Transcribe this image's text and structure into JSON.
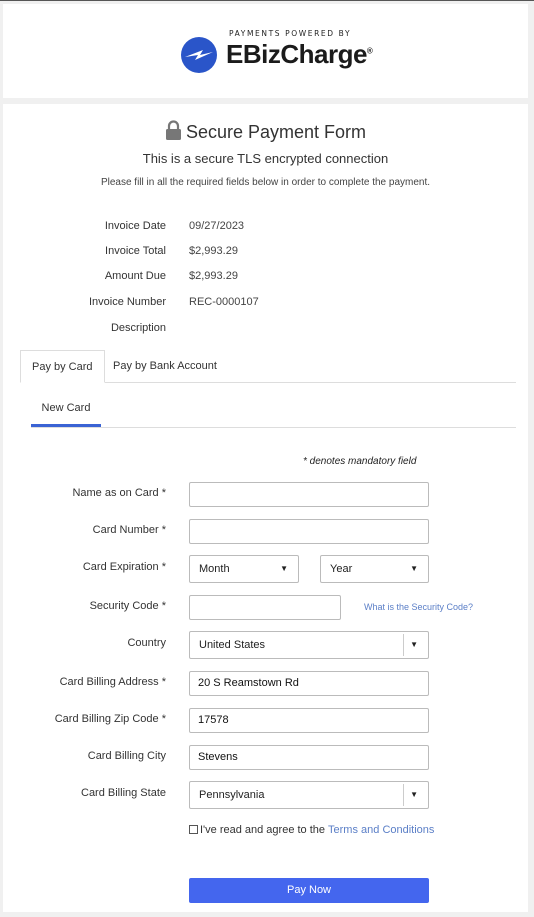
{
  "brand": {
    "tagline": "PAYMENTS POWERED BY",
    "name": "EBizCharge",
    "trademark": "®",
    "logo_icon": "lightning-circle-icon",
    "accent_color": "#2a55c9"
  },
  "form": {
    "title": "Secure Payment Form",
    "subtitle": "This is a secure TLS encrypted connection",
    "instruction": "Please fill in all the required fields below in order to complete the payment."
  },
  "invoice": {
    "items": [
      {
        "label": "Invoice Date",
        "value": "09/27/2023"
      },
      {
        "label": "Invoice Total",
        "value": "$2,993.29"
      },
      {
        "label": "Amount Due",
        "value": "$2,993.29"
      },
      {
        "label": "Invoice Number",
        "value": "REC-0000107"
      },
      {
        "label": "Description",
        "value": ""
      }
    ]
  },
  "tabs": [
    {
      "label": "Pay by Card",
      "active": true
    },
    {
      "label": "Pay by Bank Account",
      "active": false
    }
  ],
  "subtab": {
    "label": "New Card"
  },
  "mandatory_note": "* denotes mandatory field",
  "fields": {
    "name_on_card": {
      "label": "Name as on Card *",
      "value": ""
    },
    "card_number": {
      "label": "Card Number *",
      "value": ""
    },
    "expiration": {
      "label": "Card Expiration *",
      "month": "Month",
      "year": "Year"
    },
    "security_code": {
      "label": "Security Code *",
      "value": "",
      "help": "What is the Security Code?"
    },
    "country": {
      "label": "Country",
      "value": "United States"
    },
    "billing_address": {
      "label": "Card Billing Address *",
      "value": "20 S Reamstown Rd"
    },
    "billing_zip": {
      "label": "Card Billing Zip Code *",
      "value": "17578"
    },
    "billing_city": {
      "label": "Card Billing City",
      "value": "Stevens"
    },
    "billing_state": {
      "label": "Card Billing State",
      "value": "Pennsylvania"
    }
  },
  "agreement": {
    "text": "I've read and agree to the",
    "link": "Terms and Conditions",
    "checked": false
  },
  "pay_button": {
    "label": "Pay Now",
    "color": "#4466ee"
  }
}
